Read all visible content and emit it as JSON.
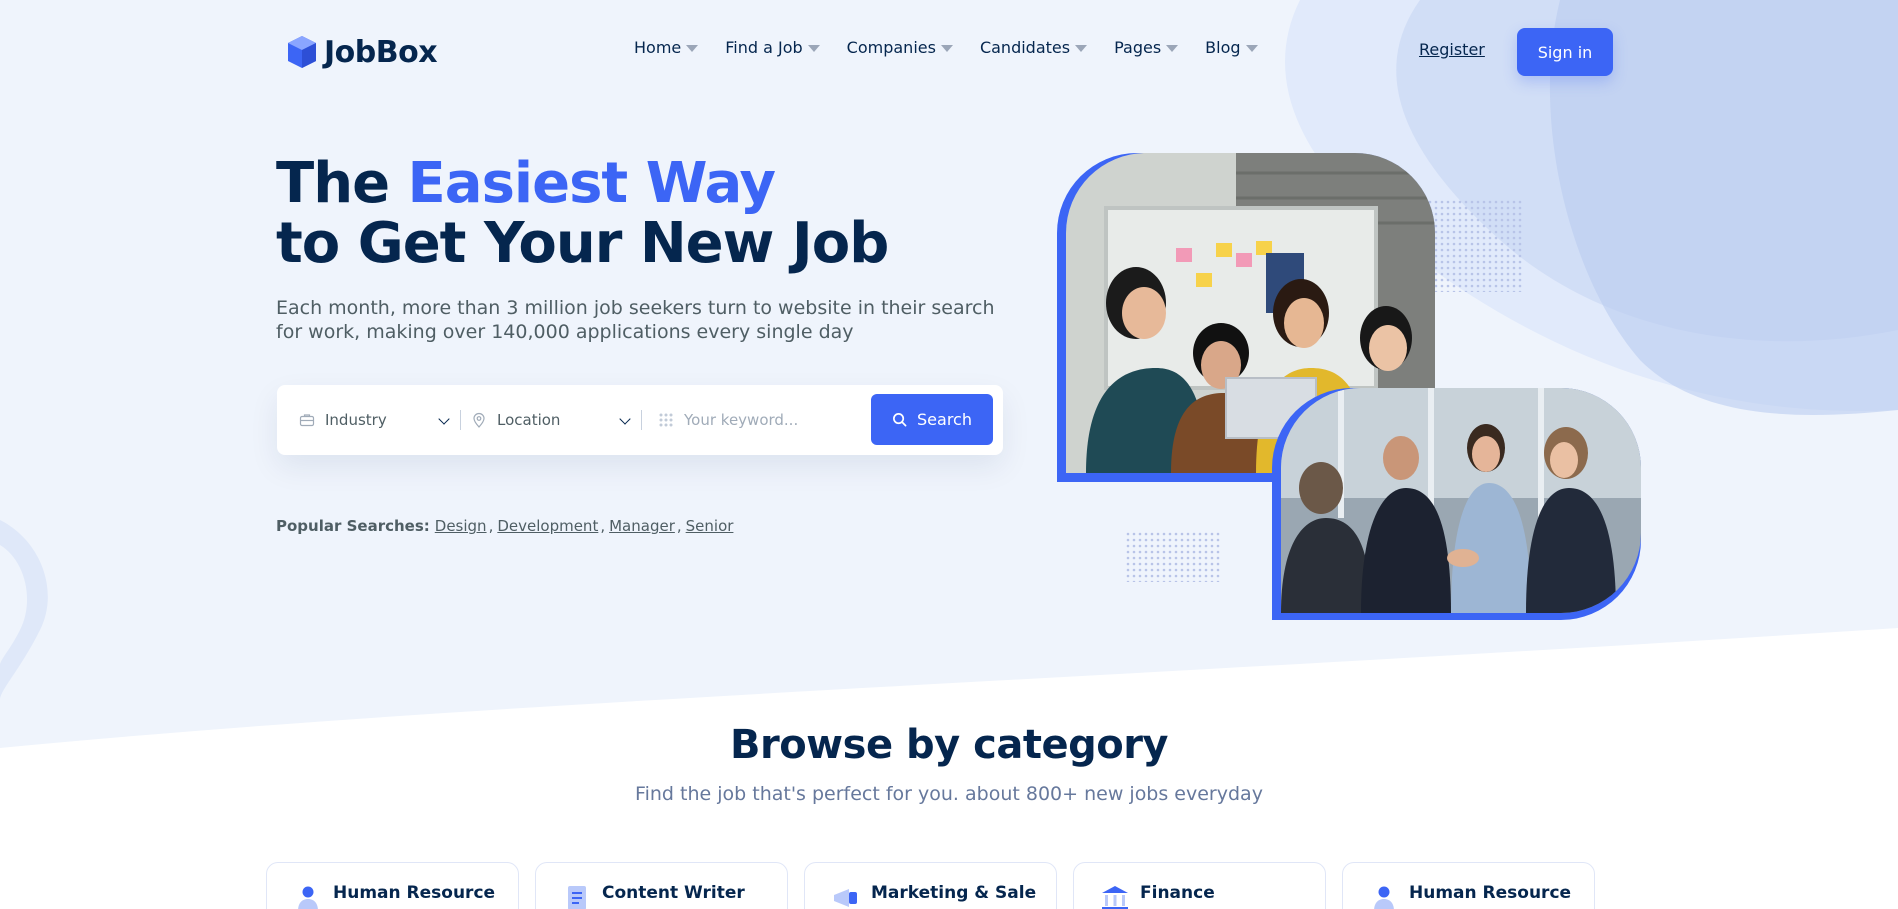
{
  "brand": {
    "name": "JobBox",
    "accent": "#3c65f5",
    "navy": "#05264e"
  },
  "nav": {
    "items": [
      {
        "label": "Home"
      },
      {
        "label": "Find a Job"
      },
      {
        "label": "Companies"
      },
      {
        "label": "Candidates"
      },
      {
        "label": "Pages"
      },
      {
        "label": "Blog"
      }
    ],
    "register_label": "Register",
    "signin_label": "Sign in"
  },
  "hero": {
    "title_prefix": "The",
    "title_highlight": "Easiest Way",
    "title_line2": "to Get Your New Job",
    "subtitle": "Each month, more than 3 million job seekers turn to website in their search for work, making over 140,000 applications every single day"
  },
  "search": {
    "industry_label": "Industry",
    "location_label": "Location",
    "keyword_placeholder": "Your keyword...",
    "button_label": "Search"
  },
  "popular": {
    "label": "Popular Searches:",
    "terms": [
      "Design",
      "Development",
      "Manager",
      "Senior"
    ]
  },
  "category": {
    "title": "Browse by category",
    "subtitle": "Find the job that's perfect for you. about 800+ new jobs everyday",
    "cards": [
      {
        "title": "Human Resource",
        "icon": "person-icon"
      },
      {
        "title": "Content Writer",
        "icon": "document-icon"
      },
      {
        "title": "Marketing & Sale",
        "icon": "megaphone-icon"
      },
      {
        "title": "Finance",
        "icon": "bank-icon"
      },
      {
        "title": "Human Resource",
        "icon": "person-icon"
      }
    ]
  }
}
